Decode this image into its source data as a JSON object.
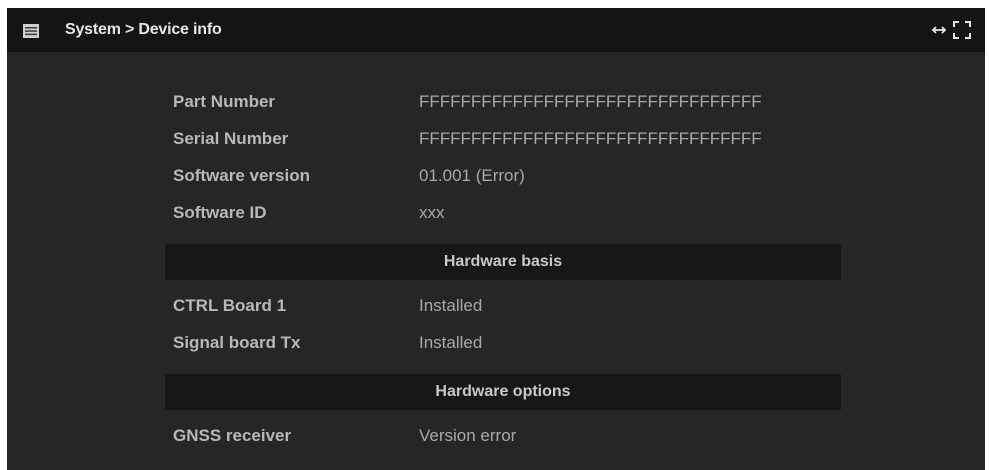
{
  "titlebar": {
    "title": "System > Device info",
    "icons": [
      "menu-icon",
      "resize-horizontal-icon",
      "fullscreen-icon"
    ]
  },
  "device_info": [
    {
      "label": "Part Number",
      "value": "FFFFFFFFFFFFFFFFFFFFFFFFFFFFFFFFF"
    },
    {
      "label": "Serial Number",
      "value": "FFFFFFFFFFFFFFFFFFFFFFFFFFFFFFFFF"
    },
    {
      "label": "Software version",
      "value": "01.001 (Error)"
    },
    {
      "label": "Software ID",
      "value": "xxx"
    }
  ],
  "hardware_basis": {
    "heading": "Hardware basis",
    "rows": [
      {
        "label": "CTRL Board 1",
        "value": "Installed"
      },
      {
        "label": "Signal board Tx",
        "value": "Installed"
      }
    ]
  },
  "hardware_options": {
    "heading": "Hardware options",
    "rows": [
      {
        "label": "GNSS receiver",
        "value": "Version error"
      }
    ]
  },
  "colors": {
    "background": "#262626",
    "titlebar": "#141414",
    "section_header": "#171717",
    "label_text": "#b8b8b8",
    "value_text": "#a8a8a8"
  }
}
